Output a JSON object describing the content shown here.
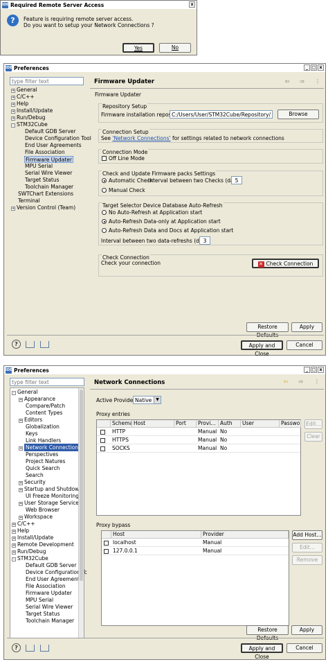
{
  "dialog": {
    "title": "Required Remote Server Access",
    "message_line1": "Feature is requiring remote server access.",
    "message_line2": "Do you want to setup your Network Connections ?",
    "yes": "Yes",
    "no": "No",
    "close": "x"
  },
  "pref1": {
    "title": "Preferences",
    "filter_placeholder": "type filter text",
    "tree": [
      "General",
      "C/C++",
      "Help",
      "Install/Update",
      "Run/Debug",
      "STM32Cube",
      "Default GDB Server",
      "Device Configuration Tool",
      "End User Agreements",
      "File Association",
      "Firmware Updater",
      "MPU Serial",
      "Serial Wire Viewer",
      "Target Status",
      "Toolchain Manager",
      "SWTChart Extensions",
      "Terminal",
      "Version Control (Team)"
    ],
    "page_title": "Firmware Updater",
    "section": "Firmware Updater",
    "repo_group": "Repository Setup",
    "repo_label": "Firmware installation repository",
    "repo_value": "C:/Users/User/STM32Cube/Repository/",
    "browse": "Browse",
    "conn_group": "Connection Setup",
    "conn_see": "See",
    "conn_link": "'Network Connections'",
    "conn_rest": "for settings related to network connections",
    "mode_group": "Connection Mode",
    "offline": "Off Line Mode",
    "check_group": "Check and Update Firmware packs Settings",
    "auto_check": "Automatic Check",
    "interval_label": "Interval between two Checks (days)",
    "interval_value": "5",
    "manual_check": "Manual Check",
    "target_group": "Target Selector Device Database Auto-Refresh",
    "no_refresh": "No Auto-Refresh at Application start",
    "data_only": "Auto-Refresh Data-only at Application start",
    "data_docs": "Auto-Refresh Data and Docs at Application start",
    "refresh_label": "Interval between two data-refreshs (days)",
    "refresh_value": "3",
    "checkconn_group": "Check Connection",
    "checkconn_text": "Check your connection",
    "checkconn_button": "Check Connection",
    "restore": "Restore Defaults",
    "apply": "Apply",
    "apply_close": "Apply and Close",
    "cancel": "Cancel"
  },
  "pref2": {
    "title": "Preferences",
    "filter_placeholder": "type filter text",
    "tree": [
      "General",
      "Appearance",
      "Compare/Patch",
      "Content Types",
      "Editors",
      "Globalization",
      "Keys",
      "Link Handlers",
      "Network Connections",
      "Perspectives",
      "Project Natures",
      "Quick Search",
      "Search",
      "Security",
      "Startup and Shutdown",
      "UI Freeze Monitoring",
      "User Storage Service",
      "Web Browser",
      "Workspace",
      "C/C++",
      "Help",
      "Install/Update",
      "Remote Development",
      "Run/Debug",
      "STM32Cube",
      "Default GDB Server",
      "Device Configuration Tc",
      "End User Agreements",
      "File Association",
      "Firmware Updater",
      "MPU Serial",
      "Serial Wire Viewer",
      "Target Status",
      "Toolchain Manager"
    ],
    "page_title": "Network Connections",
    "active_provider_label": "Active Provider:",
    "active_provider_value": "Native",
    "proxy_entries": "Proxy entries",
    "columns": [
      "Schema",
      "Host",
      "Port",
      "Provi...",
      "Auth",
      "User",
      "Passwor"
    ],
    "rows": [
      {
        "schema": "HTTP",
        "provider": "Manual",
        "auth": "No"
      },
      {
        "schema": "HTTPS",
        "provider": "Manual",
        "auth": "No"
      },
      {
        "schema": "SOCKS",
        "provider": "Manual",
        "auth": "No"
      }
    ],
    "edit": "Edit...",
    "clear": "Clear",
    "proxy_bypass": "Proxy bypass",
    "bypass_columns": [
      "Host",
      "Provider"
    ],
    "bypass_rows": [
      {
        "host": "localhost",
        "provider": "Manual"
      },
      {
        "host": "127.0.0.1",
        "provider": "Manual"
      }
    ],
    "add_host": "Add Host...",
    "edit2": "Edit...",
    "remove": "Remove",
    "restore": "Restore Defaults",
    "apply": "Apply",
    "apply_close": "Apply and Close",
    "cancel": "Cancel"
  }
}
